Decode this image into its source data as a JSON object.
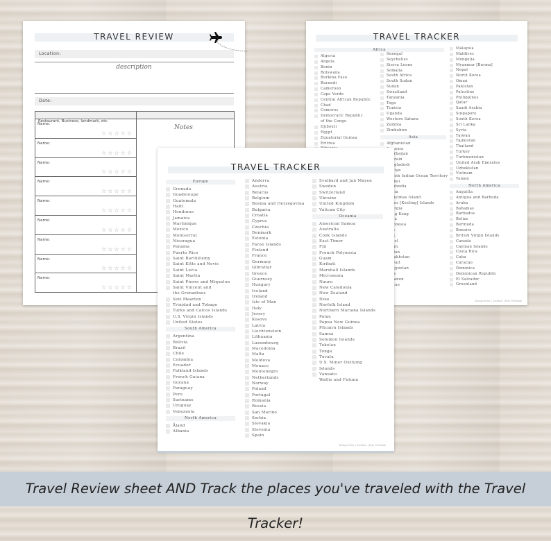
{
  "review": {
    "title": "TRAVEL REVIEW",
    "location_label": "Location:",
    "description_label": "description",
    "date_label": "Date:",
    "table_header": "Restaurant, Business, landmark, etc.",
    "notes_label": "Notes",
    "name_label": "Name:",
    "rows": 9,
    "rating_stars": 5,
    "icon": "airplane-icon"
  },
  "tracker_back": {
    "title": "TRAVEL TRACKER",
    "footer": "Designed by | Creative | Etsy Printable",
    "col1": [
      {
        "h": "Africa"
      },
      "Algeria",
      "Angola",
      "Benin",
      "Botswana",
      "Burkina Faso",
      "Burundi",
      "Cameroon",
      "Cape Verde",
      "Central African Republic",
      "Chad",
      "Comoros",
      "Democratic Republic",
      {
        "t": "of the Congo",
        "nocb": true
      },
      "Djibouti",
      "Egypt",
      "Equatorial Guinea",
      "Eritrea",
      "Ethiopia"
    ],
    "col2": [
      "Senegal",
      "Seychelles",
      "Sierra Leone",
      "Somalia",
      "South Africa",
      "South Sudan",
      "Sudan",
      "Swaziland",
      "Tanzania",
      "Togo",
      "Tunisia",
      "Uganda",
      "Western Sahara",
      "Zambia",
      "Zimbabwe",
      {
        "h": "Asia"
      },
      "Afghanistan",
      "Armenia",
      "Azerbaijan",
      "Bahrain",
      "Bangladesh",
      "Bhutan",
      "British Indian Ocean Territory",
      "Brunei",
      "Cambodia",
      "China",
      "Christmas Island",
      "Cocos [Keeling] Islands",
      "Georgia",
      "Hong Kong",
      "India",
      "Indonesia",
      "Iran",
      "Iraq",
      "Israel",
      "Japan",
      "Jordan",
      "Kazakhstan",
      "Kuwait",
      "Kyrgyzstan",
      "Laos",
      "Lebanon",
      "Macao"
    ],
    "col3": [
      "Malaysia",
      "Maldives",
      "Mongolia",
      "Myanmar [Burma]",
      "Nepal",
      "North Korea",
      "Oman",
      "Pakistan",
      "Palestine",
      "Philippines",
      "Qatar",
      "Saudi Arabia",
      "Singapore",
      "South Korea",
      "Sri Lanka",
      "Syria",
      "Taiwan",
      "Tajikistan",
      "Thailand",
      "Turkey",
      "Turkmenistan",
      "United Arab Emirates",
      "Uzbekistan",
      "Vietnam",
      "Yemen",
      {
        "h": "North America"
      },
      "Anguilla",
      "Antigua and Barbuda",
      "Aruba",
      "Bahamas",
      "Barbados",
      "Belize",
      "Bermuda",
      "Bonaire",
      "British Virgin Islands",
      "Canada",
      "Cayman Islands",
      "Costa Rica",
      "Cuba",
      "Curacao",
      "Dominica",
      "Dominican Republic",
      "El Salvador",
      "Greenland"
    ]
  },
  "tracker_front": {
    "title": "TRAVEL TRACKER",
    "footer": "Designed by | Creative | Etsy Printable",
    "col1": [
      {
        "h": "Europe"
      },
      "Grenada",
      "Guadeloupe",
      "Guatemala",
      "Haiti",
      "Honduras",
      "Jamaica",
      "Martinique",
      "Mexico",
      "Montserrat",
      "Nicaragua",
      "Panama",
      "Puerto Rico",
      "Saint Barthélemy",
      "Saint Kitts and Nevis",
      "Saint Lucia",
      "Saint Martin",
      "Saint Pierre and Miquelon",
      "Saint Vincent and",
      {
        "t": "the Grenadines",
        "nocb": true
      },
      "Sint Maarten",
      "Trinidad and Tobago",
      "Turks and Caicos Islands",
      "U.S. Virgin Islands",
      "United States",
      {
        "h": "South America"
      },
      "Argentina",
      "Bolivia",
      "Brazil",
      "Chile",
      "Colombia",
      "Ecuador",
      "Falkland Islands",
      "French Guiana",
      "Guyana",
      "Paraguay",
      "Peru",
      "Suriname",
      "Uruguay",
      "Venezuela",
      {
        "h": "North America"
      },
      "Åland",
      "Albania"
    ],
    "col2": [
      "Andorra",
      "Austria",
      "Belarus",
      "Belgium",
      "Bosnia and Herzegovina",
      "Bulgaria",
      "Croatia",
      "Cyprus",
      "Czechia",
      "Denmark",
      "Estonia",
      "Faroe Islands",
      "Finland",
      "France",
      "Germany",
      "Gibraltar",
      "Greece",
      "Guernsey",
      "Hungary",
      "Iceland",
      "Ireland",
      "Isle of Man",
      "Italy",
      "Jersey",
      "Kosovo",
      "Latvia",
      "Liechtenstein",
      "Lithuania",
      "Luxembourg",
      "Macedonia",
      "Malta",
      "Moldova",
      "Monaco",
      "Montenegro",
      "Netherlands",
      "Norway",
      "Poland",
      "Portugal",
      "Romania",
      "Russia",
      "San Marino",
      "Serbia",
      "Slovakia",
      "Slovenia",
      "Spain"
    ],
    "col3": [
      "Svalbard and Jan Mayen",
      "Sweden",
      "Switzerland",
      "Ukraine",
      "United Kingdom",
      "Vatican City",
      {
        "h": "Oceania"
      },
      "American Samoa",
      "Australia",
      "Cook Islands",
      "East Timor",
      "Fiji",
      "French Polynesia",
      "Guam",
      "Kiribati",
      "Marshall Islands",
      "Micronesia",
      "Nauru",
      "New Caledonia",
      "New Zealand",
      "Niue",
      "Norfolk Island",
      "Northern Mariana Islands",
      "Palau",
      "Papua New Guinea",
      "Pitcairn Islands",
      "Samoa",
      "Solomon Islands",
      "Tokelau",
      "Tonga",
      "Tuvalu",
      "U.S. Minor Outlying",
      {
        "t": "Islands",
        "nocb": false
      },
      "Vanuatu",
      {
        "t": "Wallis and Futuna",
        "nocb": true
      }
    ]
  },
  "caption": "Travel Review sheet AND Track the places you've traveled with the Travel Tracker!",
  "colors": {
    "caption_band": "#c6cfd8",
    "title_bar": "#eef1f4",
    "field_bg": "#efefef"
  }
}
